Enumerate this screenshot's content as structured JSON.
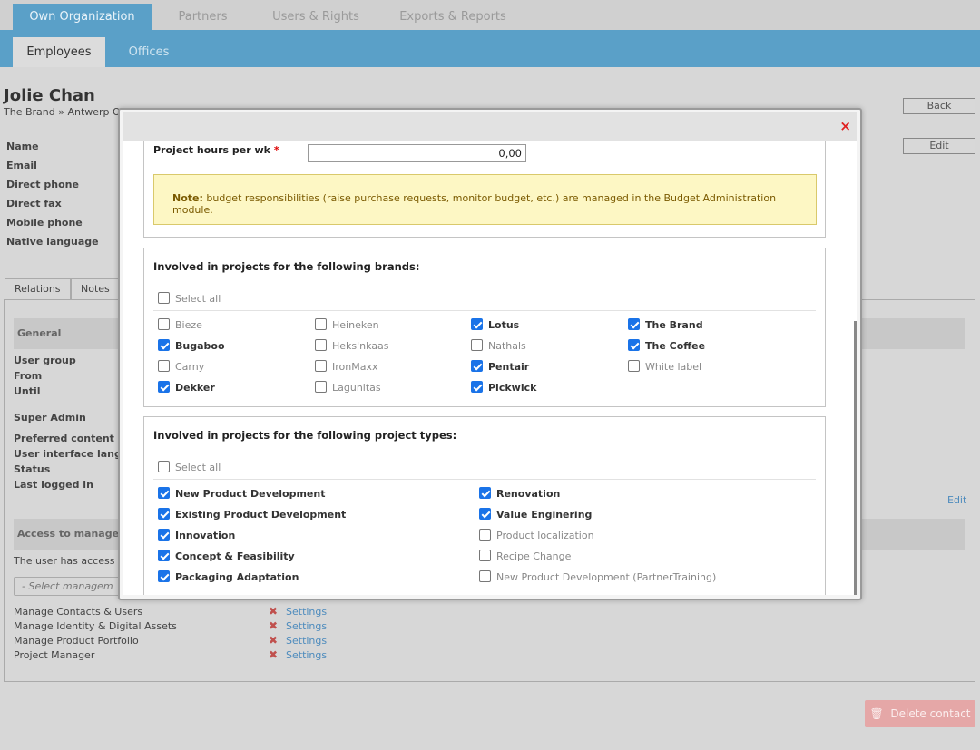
{
  "top_tabs": [
    "Own Organization",
    "Partners",
    "Users & Rights",
    "Exports & Reports"
  ],
  "sub_tabs": [
    "Employees",
    "Offices"
  ],
  "person": {
    "name": "Jolie Chan",
    "path": "The Brand » Antwerp Of"
  },
  "buttons": {
    "back": "Back",
    "edit": "Edit",
    "delete": "Delete contact",
    "edit_link": "Edit"
  },
  "fields": [
    "Name",
    "Email",
    "Direct phone",
    "Direct fax",
    "Mobile phone",
    "Native language"
  ],
  "bg_tabs": [
    "Relations",
    "Notes"
  ],
  "general": {
    "title": "General",
    "rows": [
      "User group",
      "From",
      "Until",
      "Super Admin",
      "Preferred content lan",
      "User interface langua",
      "Status",
      "Last logged in"
    ]
  },
  "access": {
    "title": "Access to manageme",
    "text": "The user has access t",
    "select_placeholder": "- Select managem",
    "items": [
      "Manage Contacts & Users",
      "Manage Identity & Digital Assets",
      "Manage Product Portfolio",
      "Project Manager"
    ],
    "settings_label": "Settings"
  },
  "modal": {
    "close_icon": "×",
    "hours_label": "Project hours per wk",
    "required_mark": "*",
    "hours_value": "0,00",
    "note_bold": "Note:",
    "note_text": "budget responsibilities (raise purchase requests, monitor budget, etc.) are managed in the Budget Administration module.",
    "brands": {
      "title": "Involved in projects for the following brands:",
      "select_all": "Select all",
      "items": [
        {
          "label": "Bieze",
          "checked": false
        },
        {
          "label": "Bugaboo",
          "checked": true
        },
        {
          "label": "Carny",
          "checked": false
        },
        {
          "label": "Dekker",
          "checked": true
        },
        {
          "label": "Heineken",
          "checked": false
        },
        {
          "label": "Heks'nkaas",
          "checked": false
        },
        {
          "label": "IronMaxx",
          "checked": false
        },
        {
          "label": "Lagunitas",
          "checked": false
        },
        {
          "label": "Lotus",
          "checked": true
        },
        {
          "label": "Nathals",
          "checked": false
        },
        {
          "label": "Pentair",
          "checked": true
        },
        {
          "label": "Pickwick",
          "checked": true
        },
        {
          "label": "The Brand",
          "checked": true
        },
        {
          "label": "The Coffee",
          "checked": true
        },
        {
          "label": "White label",
          "checked": false
        }
      ]
    },
    "types": {
      "title": "Involved in projects for the following project types:",
      "select_all": "Select all",
      "items": [
        {
          "label": "New Product Development",
          "checked": true
        },
        {
          "label": "Existing Product Development",
          "checked": true
        },
        {
          "label": "Innovation",
          "checked": true
        },
        {
          "label": "Concept & Feasibility",
          "checked": true
        },
        {
          "label": "Packaging Adaptation",
          "checked": true
        },
        {
          "label": "Renovation",
          "checked": true
        },
        {
          "label": "Value Enginering",
          "checked": true
        },
        {
          "label": "Product localization",
          "checked": false
        },
        {
          "label": "Recipe Change",
          "checked": false
        },
        {
          "label": "New Product Development (PartnerTraining)",
          "checked": false
        }
      ]
    }
  },
  "colors": {
    "accent": "#5aa0c8",
    "check": "#1a73e8",
    "close": "#e02020",
    "note_bg": "#fdf7c4",
    "note_text": "#7a5a00"
  }
}
